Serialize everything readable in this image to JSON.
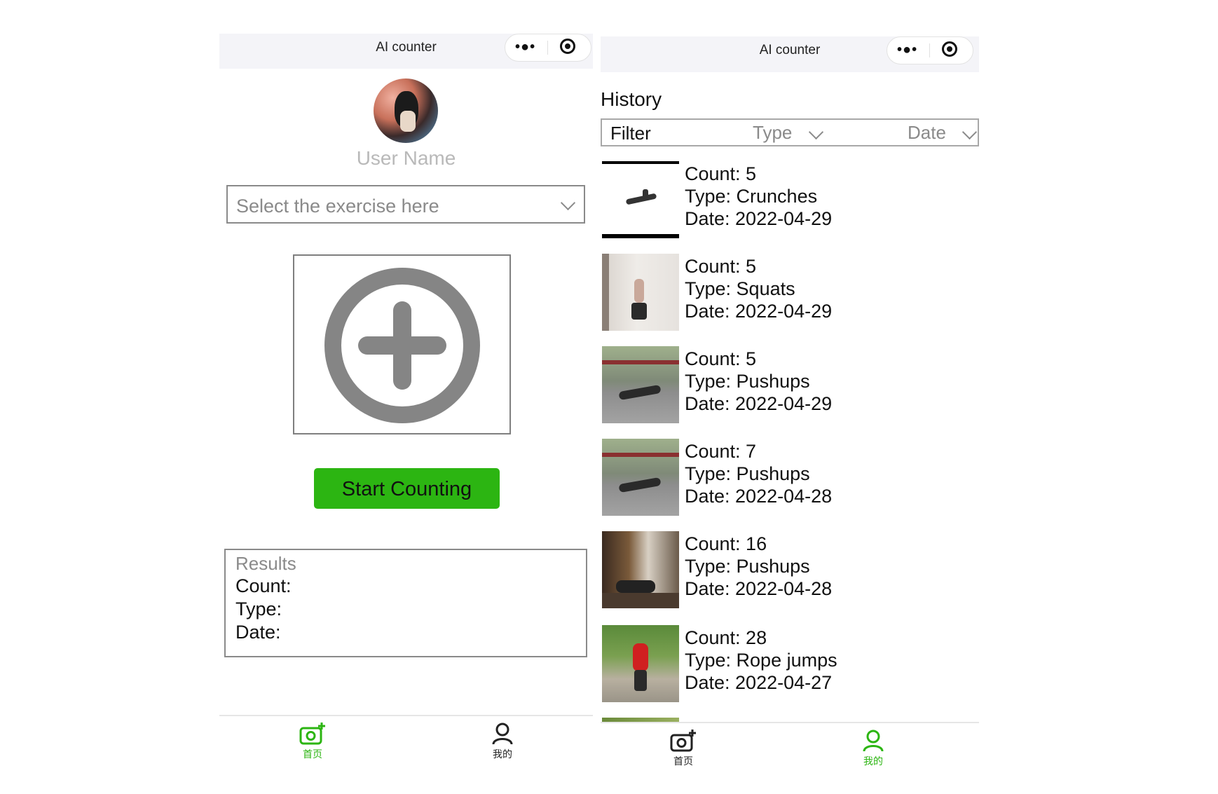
{
  "left_panel": {
    "nav": {
      "title": "AI counter",
      "more_icon": "more-dots-icon",
      "close_icon": "target-circle-icon"
    },
    "user": {
      "name": "User Name"
    },
    "exercise_select": {
      "placeholder": "Select the exercise here"
    },
    "upload": {
      "icon": "plus-circle-icon"
    },
    "start_button": {
      "label": "Start Counting",
      "color": "#2cb512"
    },
    "results": {
      "title": "Results",
      "count_label": "Count:",
      "type_label": "Type:",
      "date_label": "Date:"
    },
    "tabbar": {
      "tabs": [
        {
          "label": "首页",
          "icon": "camera-plus-icon",
          "active": true
        },
        {
          "label": "我的",
          "icon": "user-icon",
          "active": false
        }
      ]
    }
  },
  "right_panel": {
    "nav": {
      "title": "AI counter",
      "more_icon": "more-dots-icon",
      "close_icon": "target-circle-icon"
    },
    "history_title": "History",
    "filter": {
      "label": "Filter",
      "type_label": "Type",
      "date_label": "Date"
    },
    "history_items": [
      {
        "count": "Count: 5",
        "type": "Type: Crunches",
        "date": "Date: 2022-04-29"
      },
      {
        "count": "Count: 5",
        "type": "Type: Squats",
        "date": "Date: 2022-04-29"
      },
      {
        "count": "Count: 5",
        "type": "Type: Pushups",
        "date": "Date: 2022-04-29"
      },
      {
        "count": "Count: 7",
        "type": "Type: Pushups",
        "date": "Date: 2022-04-28"
      },
      {
        "count": "Count: 16",
        "type": "Type: Pushups",
        "date": "Date: 2022-04-28"
      },
      {
        "count": "Count: 28",
        "type": "Type: Rope jumps",
        "date": "Date: 2022-04-27"
      }
    ],
    "tabbar": {
      "tabs": [
        {
          "label": "首页",
          "icon": "camera-plus-icon",
          "active": false
        },
        {
          "label": "我的",
          "icon": "user-icon",
          "active": true
        }
      ]
    }
  },
  "colors": {
    "accent": "#2cb512",
    "muted_text": "#8a8a8a",
    "nav_bg": "#f4f4f8"
  }
}
